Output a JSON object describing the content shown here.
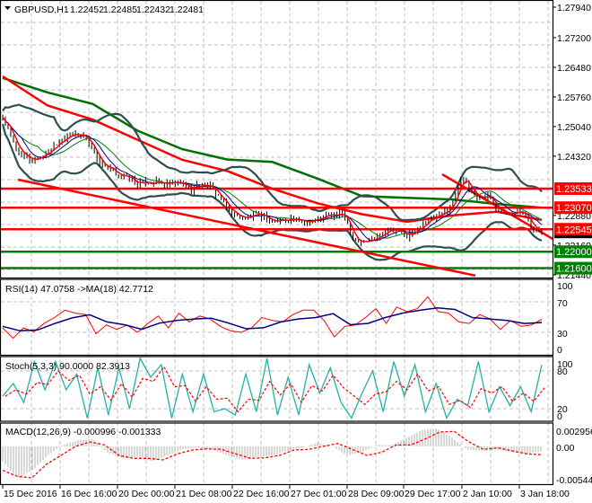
{
  "header": {
    "symbol": "GBPUSD,H1",
    "open": "1.22452",
    "high": "1.22485",
    "low": "1.22432",
    "close": "1.22481"
  },
  "price_axis": {
    "ticks": [
      "1.27940",
      "1.27200",
      "1.26480",
      "1.25760",
      "1.25040",
      "1.24320",
      "1.22880",
      "1.22160",
      "1.21440"
    ]
  },
  "levels": [
    {
      "price": "1.23533",
      "color": "#ff0000"
    },
    {
      "price": "1.23070",
      "color": "#ff0000"
    },
    {
      "price": "1.22545",
      "color": "#ff0000"
    },
    {
      "price": "1.22000",
      "color": "#008000"
    },
    {
      "price": "1.21600",
      "color": "#008000"
    }
  ],
  "current_price": "1.22481",
  "time_axis": [
    "15 Dec 2016",
    "16 Dec 16:00",
    "20 Dec 00:00",
    "21 Dec 08:00",
    "22 Dec 16:00",
    "27 Dec 01:00",
    "28 Dec 09:00",
    "29 Dec 17:00",
    "2 Jan 10:00",
    "3 Jan 18:00"
  ],
  "rsi": {
    "label": "RSI(14) 47.0758  ->MA(18) 42.7712",
    "ticks": [
      "100",
      "70",
      "30",
      "0"
    ]
  },
  "stoch": {
    "label": "Stoch(5,3,3) 90.0000 82.3913",
    "ticks": [
      "100",
      "80",
      "20",
      "0"
    ]
  },
  "macd": {
    "label": "MACD(12,26,9) -0.000996 -0.001333",
    "ticks": [
      "0.002956",
      "0.00",
      "-0.005445"
    ]
  },
  "chart_data": {
    "type": "line",
    "title": "GBPUSD,H1",
    "x_range": [
      "15 Dec 2016",
      "3 Jan 18:00"
    ],
    "ylim": [
      1.2144,
      1.2794
    ],
    "close": [
      1.2528,
      1.2473,
      1.2436,
      1.2423,
      1.243,
      1.2441,
      1.2467,
      1.248,
      1.2484,
      1.2484,
      1.2451,
      1.2408,
      1.2397,
      1.2386,
      1.2379,
      1.2364,
      1.2369,
      1.2369,
      1.2364,
      1.2366,
      1.2364,
      1.2353,
      1.2364,
      1.2358,
      1.2336,
      1.2305,
      1.2288,
      1.2281,
      1.2288,
      1.2288,
      1.2273,
      1.2277,
      1.2281,
      1.2273,
      1.2277,
      1.2277,
      1.2288,
      1.2288,
      1.2292,
      1.2233,
      1.2222,
      1.2229,
      1.2244,
      1.2255,
      1.2249,
      1.2238,
      1.2251,
      1.2273,
      1.2281,
      1.2292,
      1.2314,
      1.2386,
      1.2349,
      1.2331,
      1.2336,
      1.2305,
      1.2299,
      1.2294,
      1.23,
      1.2248,
      1.2248
    ],
    "ma_slow_red": [
      1.2626,
      1.2555,
      1.2521,
      1.2472,
      1.2423,
      1.2396,
      1.2353,
      1.2318,
      1.2291,
      1.2273,
      1.2288,
      1.2297,
      1.2277
    ],
    "ma_slowest_green": [
      1.2622,
      1.2587,
      1.2559,
      1.2494,
      1.2449,
      1.2424,
      1.2418,
      1.2378,
      1.2335,
      1.2331,
      1.2327,
      1.2316,
      1.2307
    ],
    "trend_lines": [
      {
        "from": [
          1.7,
          1.2375
        ],
        "to": [
          52.7,
          1.2142
        ],
        "color": "#ff0000"
      },
      {
        "from": [
          49,
          1.2388
        ],
        "to": [
          61.4,
          1.223
        ],
        "color": "#ff0000"
      }
    ],
    "rsi": {
      "ylim": [
        0,
        100
      ],
      "levels": [
        70,
        30
      ],
      "values": [
        35.8,
        22.2,
        35.8,
        30.8,
        41.7,
        49.4,
        59.1,
        55.2,
        53.3,
        28.1,
        39.7,
        33.9,
        39.7,
        30,
        41.7,
        51.4,
        35.8,
        55.2,
        43.6,
        51.4,
        47.5,
        37.8,
        31.9,
        30,
        35.8,
        49.4,
        45.5,
        43.6,
        53.3,
        59.1,
        59.1,
        45.5,
        24.1,
        37.8,
        39.7,
        49.4,
        61.1,
        41.7,
        63,
        57.2,
        61.1,
        76.6,
        57.2,
        55.2,
        43.6,
        41.7,
        53.3,
        47.5,
        33.9,
        45.5,
        37.8,
        39.7,
        47.1
      ],
      "ma": [
        37.8,
        32,
        33,
        41.7,
        49,
        53,
        43.6,
        40,
        34,
        42,
        45.5,
        47.5,
        48.6,
        42,
        34.7,
        36,
        43.6,
        47.5,
        49.4,
        54.5,
        40,
        41.7,
        49.4,
        55.2,
        59,
        62,
        60,
        49.4,
        47.5,
        45.5,
        41.7,
        42.8
      ]
    },
    "stoch": {
      "ylim": [
        0,
        100
      ],
      "levels": [
        80,
        20
      ],
      "k": [
        40,
        60,
        30,
        95,
        50,
        95,
        50,
        75,
        5,
        85,
        10,
        85,
        20,
        100,
        70,
        90,
        5,
        75,
        15,
        75,
        15,
        20,
        10,
        75,
        15,
        100,
        10,
        70,
        10,
        90,
        45,
        85,
        30,
        5,
        45,
        80,
        15,
        95,
        40,
        90,
        15,
        60,
        5,
        35,
        25,
        95,
        15,
        55,
        25,
        55,
        15,
        90
      ]
    },
    "macd": {
      "ylim": [
        -0.005445,
        0.002956
      ],
      "histogram": [
        -0.00274,
        -0.0058,
        -0.00438,
        -0.00164,
        0.00027,
        0.00109,
        0.00137,
        -0.00109,
        -0.00219,
        -0.00192,
        -0.00274,
        -0.00164,
        -0.00055,
        -0.00027,
        -0.00055,
        -0.00164,
        -0.00246,
        -0.00192,
        -0.00164,
        -0.00082,
        -0.00027,
        0.00066,
        0,
        -0.00164,
        -0.00109,
        0.00027,
        0.00027,
        0.00164,
        0.00301,
        0.00328,
        0.00164,
        -0.00055,
        -0.00082,
        -0.00055,
        -0.00109,
        -0.00137,
        -0.00082
      ],
      "signal": [
        -0.00438,
        -0.00547,
        -0.00575,
        -0.00328,
        -0.00164,
        0,
        0.00082,
        0.00027,
        -0.00164,
        -0.00219,
        -0.00219,
        -0.00246,
        -0.00137,
        -0.00066,
        -0.00044,
        -0.00055,
        -0.00137,
        -0.00219,
        -0.00208,
        -0.00164,
        -0.00066,
        -0.00055,
        0,
        0.00055,
        -0.00055,
        -0.00164,
        -0.00109,
        0.00027,
        0.00027,
        0.00137,
        0.00263,
        0.00274,
        0.00082,
        -0.00055,
        -0.00027,
        -0.00082,
        -0.00137,
        -0.00153
      ]
    }
  }
}
